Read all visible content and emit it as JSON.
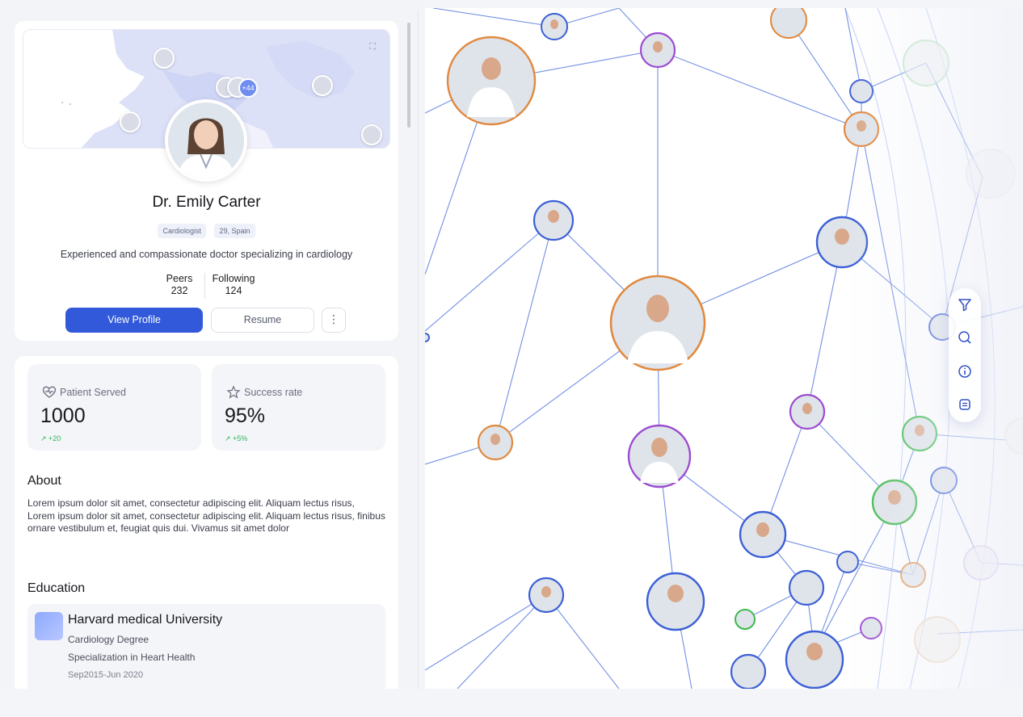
{
  "profile": {
    "name": "Dr. Emily Carter",
    "tags": [
      "Cardiologist",
      "29, Spain"
    ],
    "bio": "Experienced and compassionate doctor specializing in cardiology",
    "stats": {
      "peers_label": "Peers",
      "peers_value": "232",
      "following_label": "Following",
      "following_value": "124"
    },
    "map": {
      "pin_count": "+44",
      "expand_icon": "expand-icon"
    },
    "actions": {
      "view_profile": "View Profile",
      "resume": "Resume",
      "more": "⋮"
    }
  },
  "metrics": [
    {
      "label": "Patient Served",
      "value": "1000",
      "delta": "+20",
      "icon": "heart-pulse-icon"
    },
    {
      "label": "Success rate",
      "value": "95%",
      "delta": "+5%",
      "icon": "star-icon"
    }
  ],
  "about": {
    "title": "About",
    "text_1": "Lorem ipsum dolor sit amet, consectetur adipiscing elit. Aliquam lectus risus,",
    "text_2": "Lorem ipsum dolor sit amet, consectetur adipiscing elit. Aliquam lectus risus, finibus ornare vestibulum et, feugiat quis dui. Vivamus sit amet dolor"
  },
  "education": {
    "title": "Education",
    "school": "Harvard medical University",
    "degree": "Cardiology Degree",
    "specialization": "Specialization in Heart Health",
    "dates": "Sep2015-Jun 2020"
  },
  "graph_tools": [
    {
      "name": "filter",
      "icon": "filter-icon"
    },
    {
      "name": "search",
      "icon": "search-icon"
    },
    {
      "name": "info",
      "icon": "info-icon"
    },
    {
      "name": "layout",
      "icon": "toggle-icon"
    }
  ],
  "colors": {
    "primary": "#3159d9",
    "edge": "#5a7ce0",
    "node_blue": "#3b5fd6",
    "node_orange": "#e0893f",
    "node_purple": "#9b4bd1",
    "node_green": "#3fb94e",
    "delta_green": "#2fb35a"
  }
}
